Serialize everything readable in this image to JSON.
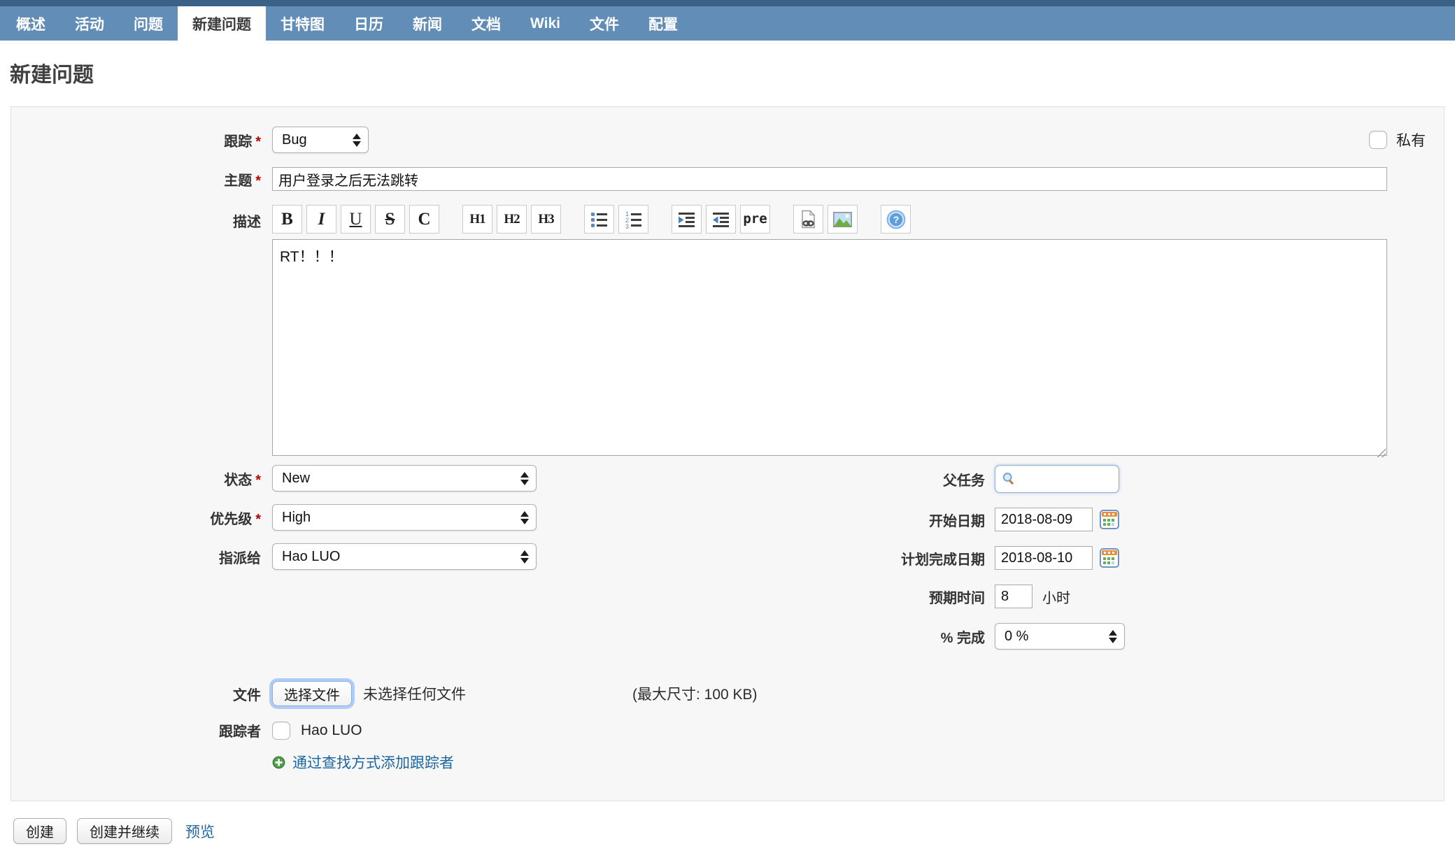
{
  "colors": {
    "nav_bar": "#628db6",
    "nav_top_stripe": "#3c6186",
    "link": "#1e66a0",
    "required_mark": "#bb0000"
  },
  "nav": {
    "active_index": 3,
    "tabs": [
      "概述",
      "活动",
      "问题",
      "新建问题",
      "甘特图",
      "日历",
      "新闻",
      "文档",
      "Wiki",
      "文件",
      "配置"
    ]
  },
  "page": {
    "title": "新建问题"
  },
  "form": {
    "tracker": {
      "label": "跟踪",
      "value": "Bug"
    },
    "private": {
      "label": "私有",
      "checked": false
    },
    "subject": {
      "label": "主题",
      "value": "用户登录之后无法跳转"
    },
    "description": {
      "label": "描述",
      "value": "RT！！！"
    },
    "status": {
      "label": "状态",
      "value": "New"
    },
    "priority": {
      "label": "优先级",
      "value": "High"
    },
    "assignee": {
      "label": "指派给",
      "value": "Hao LUO"
    },
    "parent_task": {
      "label": "父任务",
      "value": ""
    },
    "start_date": {
      "label": "开始日期",
      "value": "2018-08-09"
    },
    "due_date": {
      "label": "计划完成日期",
      "value": "2018-08-10"
    },
    "estimated_hours": {
      "label": "预期时间",
      "value": "8",
      "unit": "小时"
    },
    "done_ratio": {
      "label": "% 完成",
      "value": "0 %"
    },
    "files": {
      "label": "文件",
      "choose_button": "选择文件",
      "no_file_text": "未选择任何文件",
      "max_size_text": "(最大尺寸: 100 KB)"
    },
    "watchers": {
      "label": "跟踪者",
      "options": [
        {
          "label": "Hao LUO",
          "checked": false
        }
      ],
      "add_link": "通过查找方式添加跟踪者"
    }
  },
  "editor": {
    "toolbar": [
      {
        "name": "bold",
        "glyph": "B"
      },
      {
        "name": "italic",
        "glyph": "I"
      },
      {
        "name": "underline",
        "glyph": "U"
      },
      {
        "name": "strikethrough",
        "glyph": "S"
      },
      {
        "name": "code",
        "glyph": "C"
      },
      {
        "name": "heading-1",
        "glyph": "H1",
        "group": true
      },
      {
        "name": "heading-2",
        "glyph": "H2"
      },
      {
        "name": "heading-3",
        "glyph": "H3"
      },
      {
        "name": "unordered-list",
        "icon": "ul",
        "group": true
      },
      {
        "name": "ordered-list",
        "icon": "ol"
      },
      {
        "name": "indent-increase",
        "icon": "indent-r",
        "group": true
      },
      {
        "name": "indent-decrease",
        "icon": "indent-l"
      },
      {
        "name": "preformatted",
        "glyph": "pre"
      },
      {
        "name": "wiki-link",
        "icon": "link",
        "group": true
      },
      {
        "name": "image",
        "icon": "image"
      },
      {
        "name": "help",
        "icon": "help",
        "group": true
      }
    ]
  },
  "actions": {
    "create": "创建",
    "create_and_continue": "创建并继续",
    "preview": "预览"
  }
}
